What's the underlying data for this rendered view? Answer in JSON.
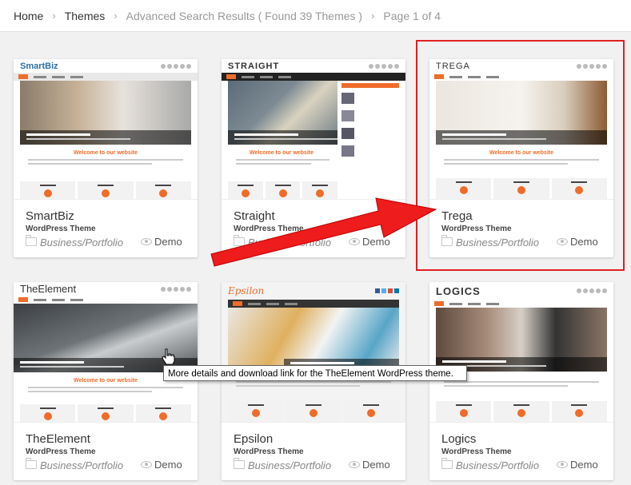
{
  "breadcrumb": {
    "home": "Home",
    "themes": "Themes",
    "results": "Advanced Search Results ( Found 39 Themes )",
    "page": "Page 1 of 4"
  },
  "themes": [
    {
      "name": "SmartBiz",
      "type": "WordPress Theme",
      "category": "Business/Portfolio",
      "demo": "Demo",
      "logo": "SmartBiz",
      "welcome": "Welcome to our website"
    },
    {
      "name": "Straight",
      "type": "WordPress Theme",
      "category": "Business/Portfolio",
      "demo": "Demo",
      "logo": "STRAIGHT",
      "welcome": "Welcome to our website"
    },
    {
      "name": "Trega",
      "type": "WordPress Theme",
      "category": "Business/Portfolio",
      "demo": "Demo",
      "logo": "TREGA",
      "welcome": "Welcome to our website"
    },
    {
      "name": "TheElement",
      "type": "WordPress Theme",
      "category": "Business/Portfolio",
      "demo": "Demo",
      "logo": "TheElement",
      "welcome": "Welcome to our website"
    },
    {
      "name": "Epsilon",
      "type": "WordPress Theme",
      "category": "Business/Portfolio",
      "demo": "Demo",
      "logo": "Epsilon",
      "welcome": ""
    },
    {
      "name": "Logics",
      "type": "WordPress Theme",
      "category": "Business/Portfolio",
      "demo": "Demo",
      "logo": "LOGICS",
      "welcome": ""
    }
  ],
  "tooltip": "More details and download link for the TheElement WordPress theme.",
  "colors": {
    "accent": "#ef6c2a",
    "highlight": "#e02020"
  }
}
